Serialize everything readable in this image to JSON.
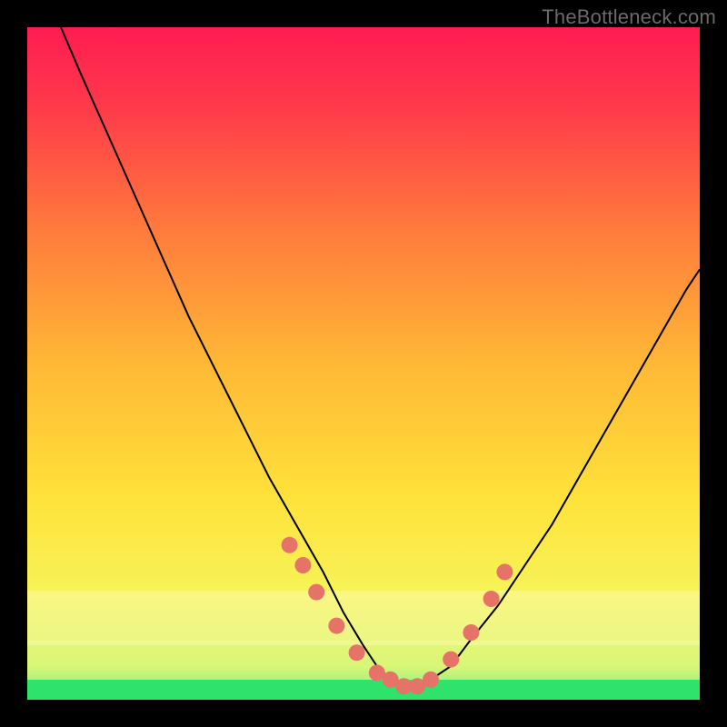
{
  "watermark": "TheBottleneck.com",
  "chart_data": {
    "type": "line",
    "title": "",
    "xlabel": "",
    "ylabel": "",
    "xlim": [
      0,
      100
    ],
    "ylim": [
      0,
      100
    ],
    "background_gradient": {
      "top": "#ff1c52",
      "mid": "#ffe23a",
      "bottom": "#2ee26b"
    },
    "series": [
      {
        "name": "curve",
        "x": [
          5,
          8,
          12,
          16,
          20,
          24,
          28,
          32,
          36,
          40,
          44,
          47,
          50,
          52,
          54,
          56,
          58,
          60,
          63,
          66,
          70,
          74,
          78,
          82,
          86,
          90,
          94,
          98,
          100
        ],
        "y": [
          100,
          93,
          84,
          75,
          66,
          57,
          49,
          41,
          33,
          26,
          19,
          13,
          8,
          5,
          3,
          2,
          2,
          3,
          5,
          9,
          14,
          20,
          26,
          33,
          40,
          47,
          54,
          61,
          64
        ],
        "note": "V-shaped curve; y estimated from plot area (0=bottom green, 100=top red)."
      }
    ],
    "dots": {
      "name": "highlighted-points",
      "color": "#e57368",
      "x": [
        39,
        41,
        43,
        46,
        49,
        52,
        54,
        56,
        58,
        60,
        63,
        66,
        69,
        71
      ],
      "y": [
        23,
        20,
        16,
        11,
        7,
        4,
        3,
        2,
        2,
        3,
        6,
        10,
        15,
        19
      ],
      "note": "Salmon dots along lower portion of the curve; values estimated."
    },
    "bands": {
      "green_bottom_fraction": 0.03,
      "pale_yellow_band_fraction": 0.12
    }
  }
}
